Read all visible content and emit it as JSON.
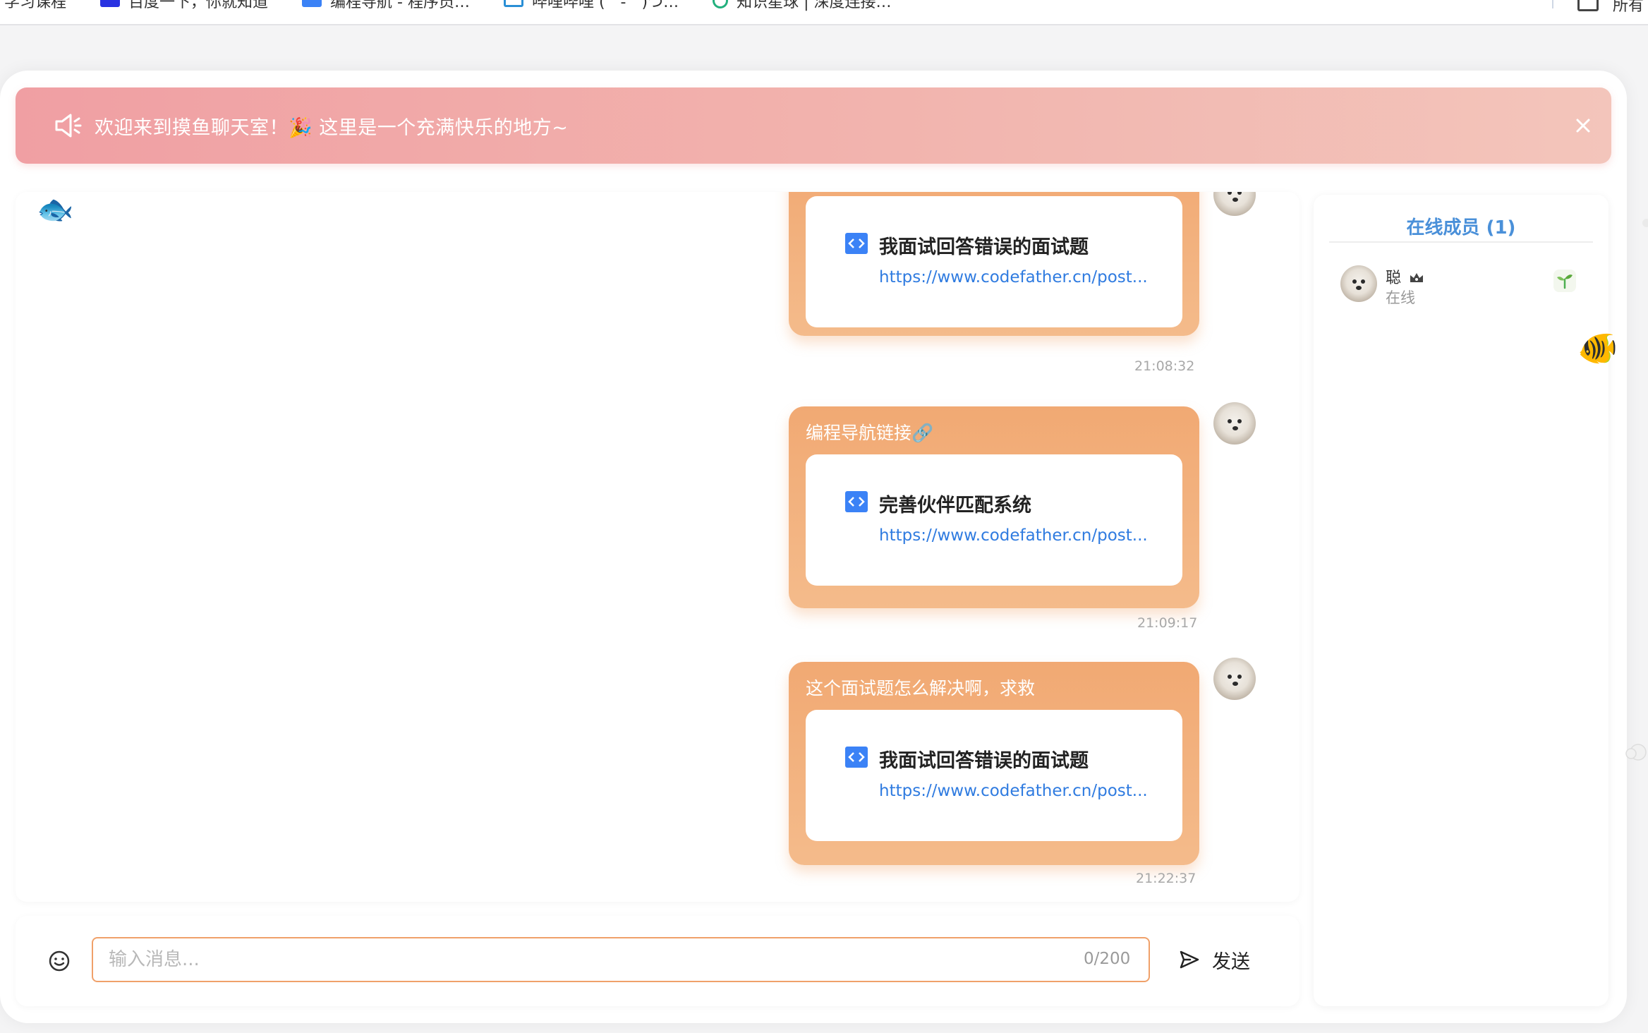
{
  "bookmarks": {
    "items": [
      {
        "label": "学习课程",
        "icon": "bookmark-icon"
      },
      {
        "label": "百度一下，你就知道",
        "icon": "baidu-icon"
      },
      {
        "label": "编程导航 - 程序员…",
        "icon": "code-nav-icon"
      },
      {
        "label": "哔哩哔哩 (゜-゜)つ…",
        "icon": "bilibili-icon"
      },
      {
        "label": "知识星球 | 深度连接…",
        "icon": "zsxq-icon"
      }
    ],
    "folder_label": "所有"
  },
  "notice": {
    "text": "欢迎来到摸鱼聊天室！🎉 这里是一个充满快乐的地方~",
    "icon": "speaker-icon"
  },
  "messages": [
    {
      "text": "",
      "card_title": "我面试回答错误的面试题",
      "card_link": "https://www.codefather.cn/post...",
      "time": "21:08:32"
    },
    {
      "text": "编程导航链接🔗",
      "card_title": "完善伙伴匹配系统",
      "card_link": "https://www.codefather.cn/post...",
      "time": "21:09:17"
    },
    {
      "text": "这个面试题怎么解决啊，求救",
      "card_title": "我面试回答错误的面试题",
      "card_link": "https://www.codefather.cn/post...",
      "time": "21:22:37"
    }
  ],
  "input": {
    "placeholder": "输入消息...",
    "value": "",
    "counter": "0/200",
    "send_label": "发送"
  },
  "sidebar": {
    "title": "在线成员 (1)",
    "members": [
      {
        "name": "聪",
        "status": "在线",
        "badge": "crown-icon",
        "level_icon": "sprout-icon"
      }
    ]
  },
  "decorations": {
    "fish_left": "🐟",
    "fish_right": "🐠"
  },
  "colors": {
    "accent": "#f1a973",
    "link": "#2f7be0",
    "title_blue": "#4a90d9",
    "notice_start": "#f09fa3",
    "notice_end": "#f3c5bb"
  }
}
